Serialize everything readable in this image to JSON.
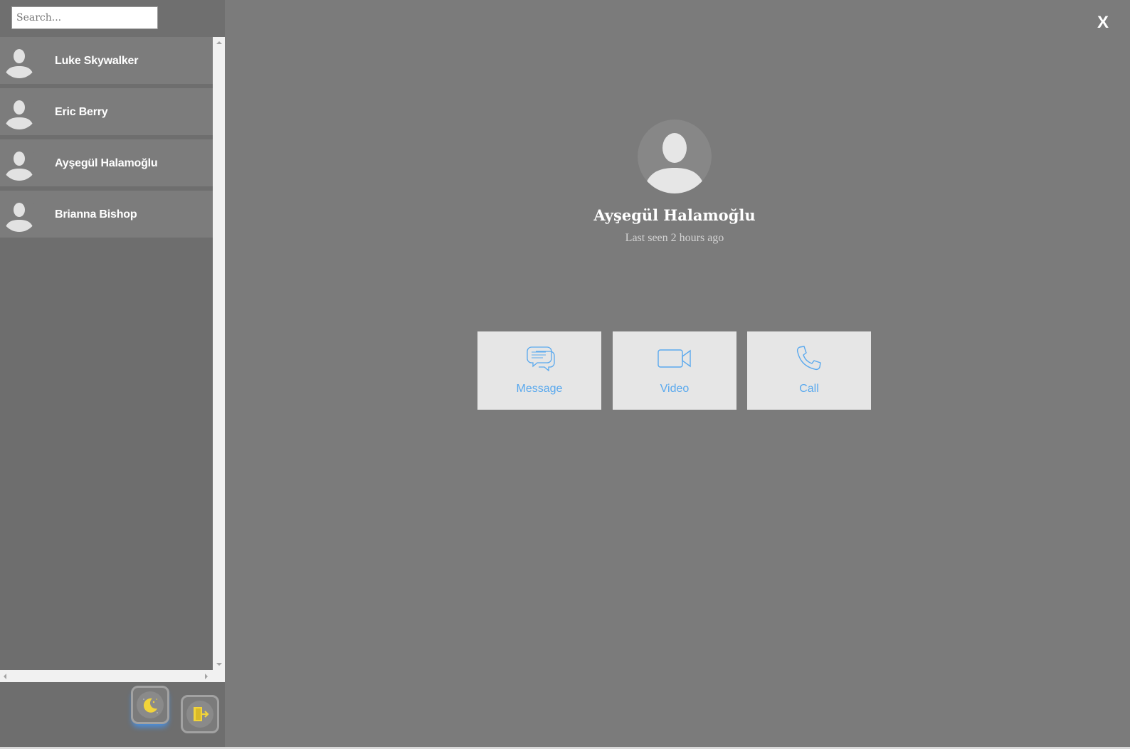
{
  "search": {
    "placeholder": "Search..."
  },
  "contacts": [
    {
      "name": "Luke Skywalker"
    },
    {
      "name": "Eric Berry"
    },
    {
      "name": "Ayşegül Halamoğlu"
    },
    {
      "name": "Brianna Bishop"
    }
  ],
  "footer": {
    "theme_icon": "moon-icon",
    "logout_icon": "door-exit-icon",
    "accent": "#f2d43a"
  },
  "main": {
    "close_label": "X",
    "profile": {
      "name": "Ayşegül Halamoğlu",
      "status": "Last seen 2 hours ago"
    },
    "actions": [
      {
        "label": "Message",
        "icon": "chat-bubbles-icon"
      },
      {
        "label": "Video",
        "icon": "video-camera-icon"
      },
      {
        "label": "Call",
        "icon": "phone-icon"
      }
    ],
    "action_color": "#5aa9ee"
  }
}
